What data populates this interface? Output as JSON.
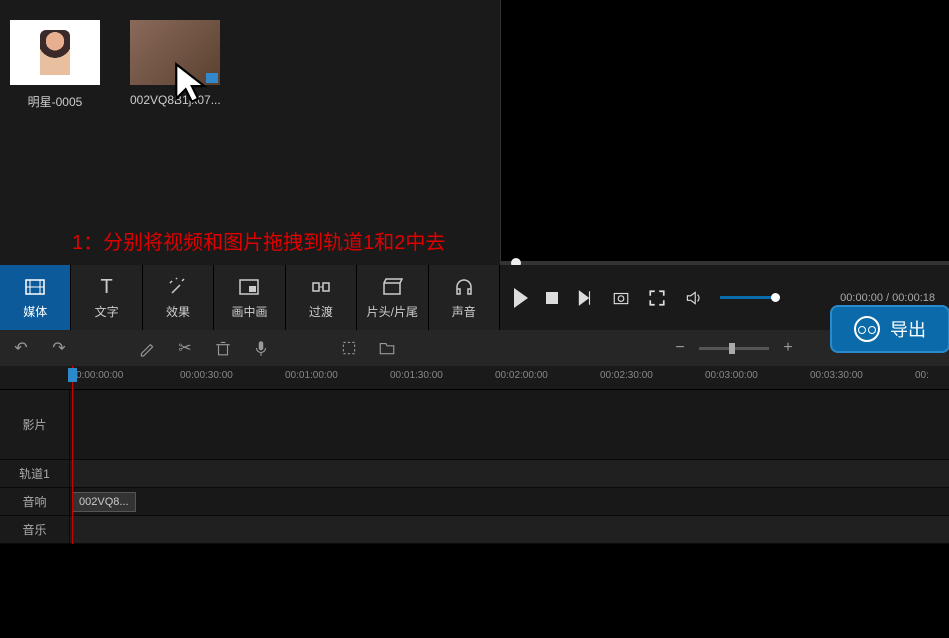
{
  "media": {
    "items": [
      {
        "label": "明星-0005",
        "kind": "photo"
      },
      {
        "label": "002VQ8B1jx07...",
        "kind": "video"
      }
    ]
  },
  "annotation": "1：分别将视频和图片拖拽到轨道1和2中去",
  "tabs": {
    "media": "媒体",
    "text": "文字",
    "effects": "效果",
    "pip": "画中画",
    "transition": "过渡",
    "intros": "片头/片尾",
    "audio": "声音"
  },
  "playback": {
    "current": "00:00:00",
    "total": "00:00:18"
  },
  "export_label": "导出",
  "ruler_ticks": [
    "0:00:00:00",
    "00:00:30:00",
    "00:01:00:00",
    "00:01:30:00",
    "00:02:00:00",
    "00:02:30:00",
    "00:03:00:00",
    "00:03:30:00",
    "00:"
  ],
  "tracks": {
    "video": "影片",
    "track1": "轨道1",
    "audio_fx": "音响",
    "music": "音乐"
  },
  "clip_label": "002VQ8..."
}
